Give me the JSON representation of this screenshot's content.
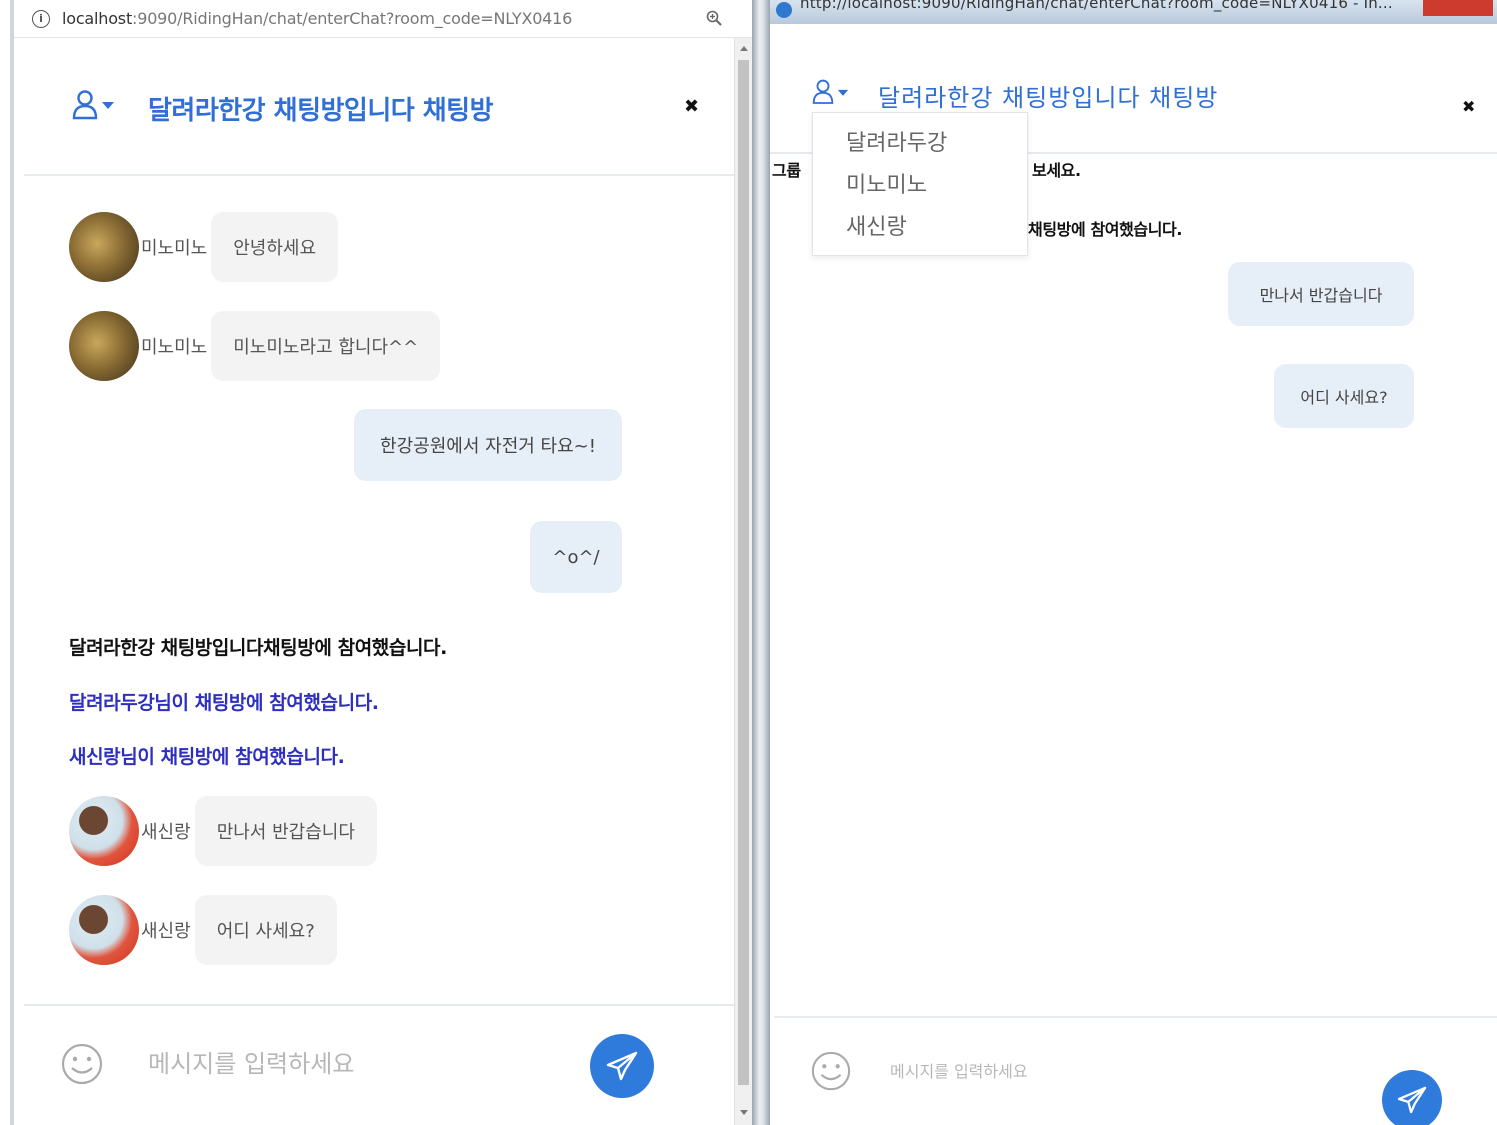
{
  "left_window": {
    "address_bar": {
      "url_host": "localhost",
      "url_rest": ":9090/RidingHan/chat/enterChat?room_code=NLYX0416"
    },
    "chat_title": "달려라한강 채팅방입니다 채팅방",
    "close_label": "✖",
    "messages": [
      {
        "sender": "미노미노",
        "text": "안녕하세요"
      },
      {
        "sender": "미노미노",
        "text": "미노미노라고 합니다^^"
      },
      {
        "mine": true,
        "text": "한강공원에서 자전거 타요~!"
      },
      {
        "mine": true,
        "text": "^o^/"
      }
    ],
    "system_messages": [
      "달려라한강 채팅방입니다채팅방에 참여했습니다.",
      "달려라두강님이 채팅방에 참여했습니다.",
      "새신랑님이 채팅방에 참여했습니다."
    ],
    "messages_after": [
      {
        "sender": "새신랑",
        "text": "만나서 반갑습니다"
      },
      {
        "sender": "새신랑",
        "text": "어디 사세요?"
      }
    ],
    "input_placeholder": "메시지를 입력하세요"
  },
  "right_window": {
    "address_bar": {
      "url": "http://localhost:9090/RidingHan/chat/enterChat?room_code=NLYX0416 - In..."
    },
    "chat_title": "달려라한강 채팅방입니다 채팅방",
    "close_label": "✖",
    "dropdown_items": [
      "달려라두강",
      "미노미노",
      "새신랑"
    ],
    "partial_left_text": "그룹",
    "partial_texts": [
      "보세요.",
      "채팅방에 참여했습니다."
    ],
    "messages": [
      {
        "mine": true,
        "text": "만나서 반갑습니다"
      },
      {
        "mine": true,
        "text": "어디 사세요?"
      }
    ],
    "input_placeholder": "메시지를 입력하세요"
  },
  "colors": {
    "accent_blue": "#2f6fd6",
    "send_button": "#2f7bdc",
    "system_black": "#111111",
    "system_blue": "#2e2fbf",
    "bubble_other": "#f3f3f4",
    "bubble_mine": "#e6eef8"
  },
  "icons": [
    "info-icon",
    "zoom-icon",
    "user-icon",
    "caret-down-icon",
    "close-icon",
    "smile-icon",
    "paper-plane-icon",
    "ie-icon"
  ]
}
